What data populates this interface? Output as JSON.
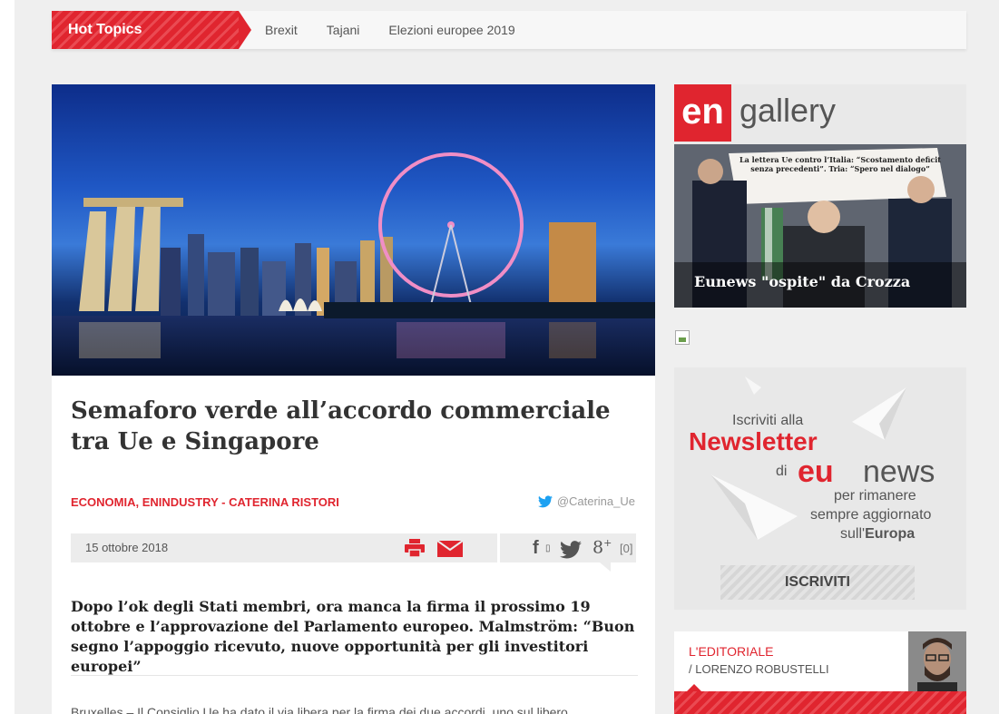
{
  "hot_topics": {
    "label": "Hot Topics",
    "links": [
      "Brexit",
      "Tajani",
      "Elezioni europee 2019"
    ]
  },
  "article": {
    "title": "Semaforo verde all’accordo commerciale tra Ue e Singapore",
    "categories": "ECONOMIA, ENINDUSTRY - CATERINA RISTORI",
    "twitter_handle": "@Caterina_Ue",
    "date": "15 ottobre 2018",
    "comment_count": "[0]",
    "lead": "Dopo l’ok degli Stati membri, ora manca la firma il prossimo 19 ottobre e l’approvazione del Parlamento europeo. Malmström: “Buon segno l’appoggio ricevuto, nuove opportunità per gli investitori europei”",
    "body_start": "Bruxelles – Il Consiglio Ue ha dato il via libera per la firma dei due accordi, uno sul libero"
  },
  "gallery": {
    "logo_text": "en",
    "heading": "gallery",
    "caption": "Eunews \"ospite\" da Crozza",
    "image_headline": "La lettera Ue contro l’Italia: “Scostamento deficit senza precedenti”. Tria: “Spero nel dialogo”"
  },
  "newsletter": {
    "line1": "Iscriviti alla",
    "big": "Newsletter",
    "di": "di",
    "brand_eu": "eu",
    "brand_news": "news",
    "line2": "per rimanere",
    "line3": "sempre aggiornato",
    "line4_pre": "sull'",
    "line4_bold": "Europa",
    "button": "ISCRIVITI"
  },
  "editorial": {
    "label": "L'EDITORIALE",
    "author": "/ LORENZO ROBUSTELLI"
  },
  "colors": {
    "accent": "#e0252f",
    "twitter": "#1da1f2"
  }
}
